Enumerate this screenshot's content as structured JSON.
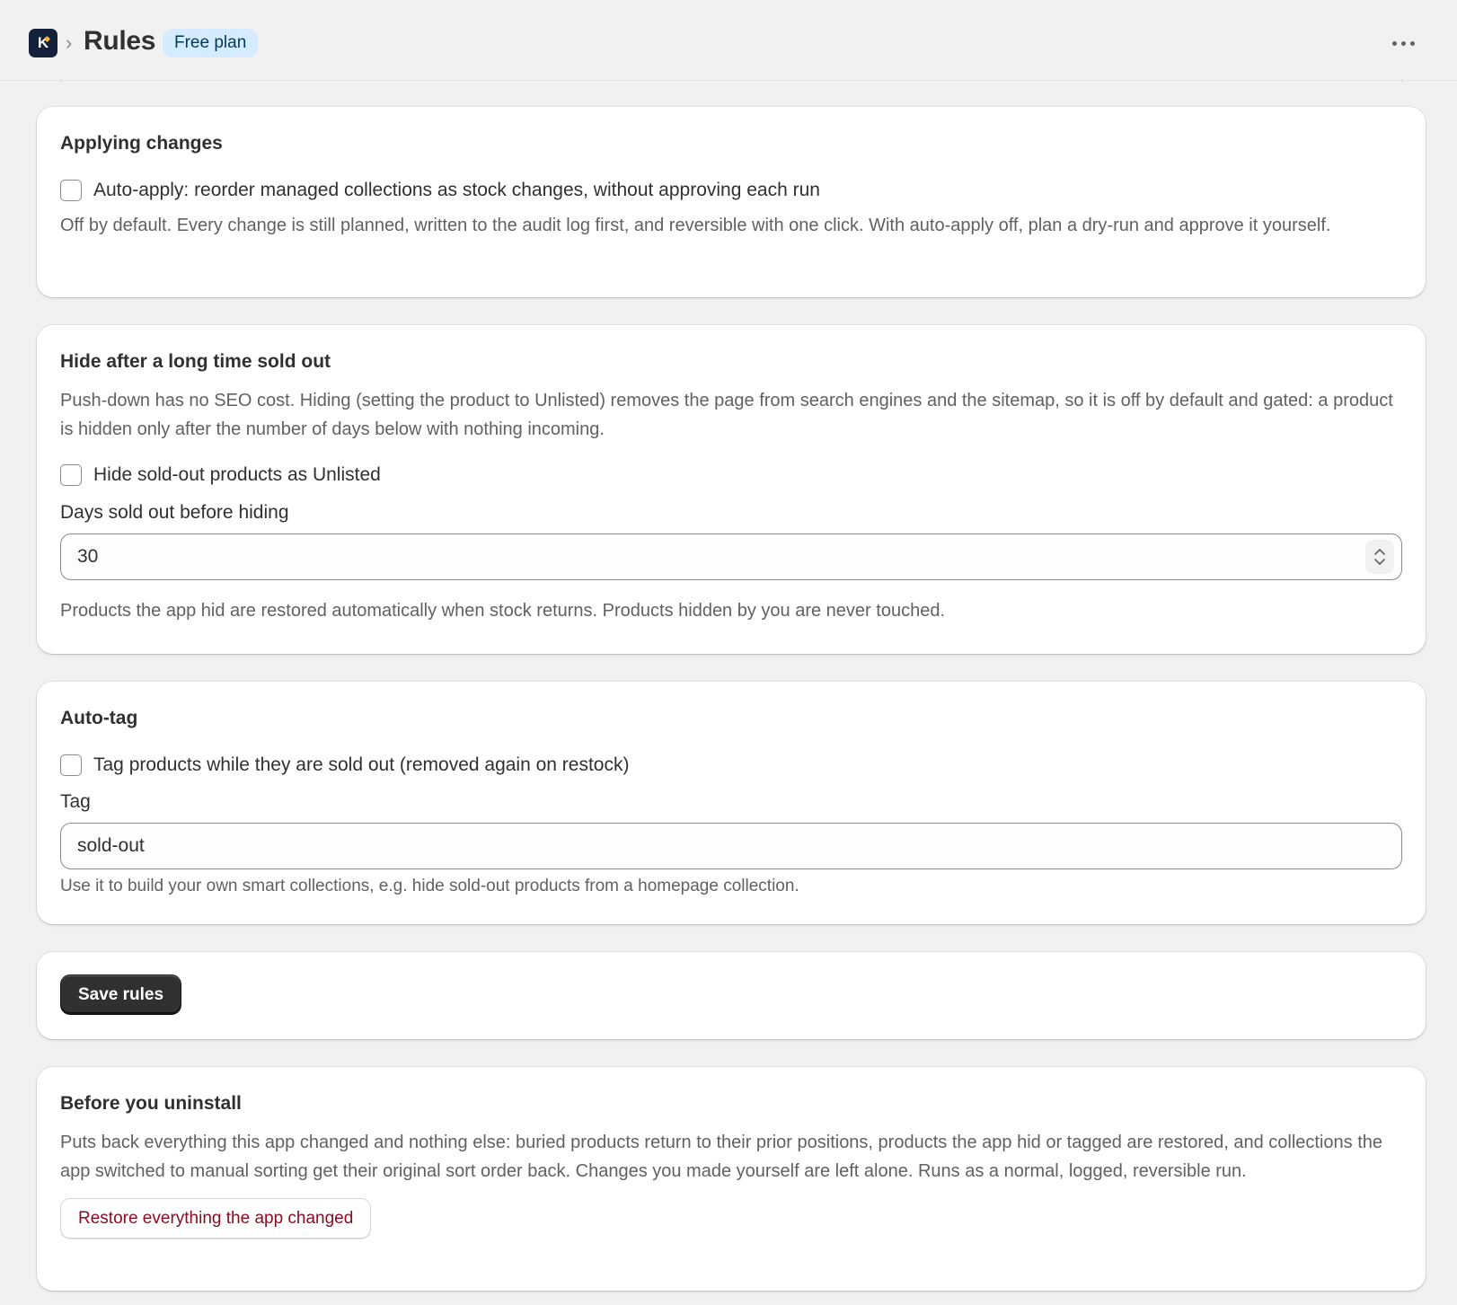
{
  "header": {
    "logo_letter": "K",
    "breadcrumb_separator": "›",
    "title": "Rules",
    "plan_badge": "Free plan",
    "more_actions_icon": "ellipsis-icon"
  },
  "applying_changes": {
    "title": "Applying changes",
    "auto_apply_label": "Auto-apply: reorder managed collections as stock changes, without approving each run",
    "auto_apply_checked": false,
    "help": "Off by default. Every change is still planned, written to the audit log first, and reversible with one click. With auto-apply off, plan a dry-run and approve it yourself."
  },
  "hide_sold_out": {
    "title": "Hide after a long time sold out",
    "description": "Push-down has no SEO cost. Hiding (setting the product to Unlisted) removes the page from search engines and the sitemap, so it is off by default and gated: a product is hidden only after the number of days below with nothing incoming.",
    "hide_label": "Hide sold-out products as Unlisted",
    "hide_checked": false,
    "days_label": "Days sold out before hiding",
    "days_value": "30",
    "help": "Products the app hid are restored automatically when stock returns. Products hidden by you are never touched."
  },
  "auto_tag": {
    "title": "Auto-tag",
    "tag_label_checkbox": "Tag products while they are sold out (removed again on restock)",
    "tag_checked": false,
    "tag_field_label": "Tag",
    "tag_value": "sold-out",
    "help": "Use it to build your own smart collections, e.g. hide sold-out products from a homepage collection."
  },
  "save": {
    "button_label": "Save rules"
  },
  "uninstall": {
    "title": "Before you uninstall",
    "description": "Puts back everything this app changed and nothing else: buried products return to their prior positions, products the app hid or tagged are restored, and collections the app switched to manual sorting get their original sort order back. Changes you made yourself are left alone. Runs as a normal, logged, reversible run.",
    "restore_button_label": "Restore everything the app changed"
  },
  "colors": {
    "page_background": "#f1f1f1",
    "card_background": "#ffffff",
    "primary_button": "#303030",
    "destructive_text": "#8e0b21",
    "badge_background": "#d5ebff"
  }
}
